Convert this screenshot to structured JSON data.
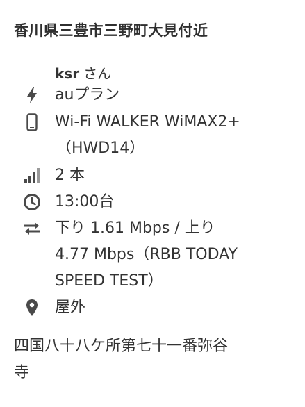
{
  "location": {
    "title": "香川県三豊市三野町大見付近"
  },
  "author": {
    "name": "ksr",
    "suffix": "さん"
  },
  "details": {
    "plan": "auプラン",
    "device_line1": "Wi-Fi WALKER WiMAX2+",
    "device_line2": "（HWD14）",
    "signal": "2 本",
    "time": "13:00台",
    "speed_line1": "下り 1.61 Mbps / 上り",
    "speed_line2": "4.77 Mbps（RBB TODAY",
    "speed_line3": "SPEED TEST）",
    "place_type": "屋外"
  },
  "place": {
    "line1": "四国八十八ケ所第七十一番弥谷",
    "line2": "寺"
  },
  "icons": {
    "plan": "lightning-icon",
    "device": "smartphone-icon",
    "signal": "signal-bars-icon",
    "time": "clock-icon",
    "speed": "transfer-arrows-icon",
    "place_type": "map-pin-icon"
  },
  "colors": {
    "text": "#333333",
    "icon": "#4a4a4a"
  }
}
